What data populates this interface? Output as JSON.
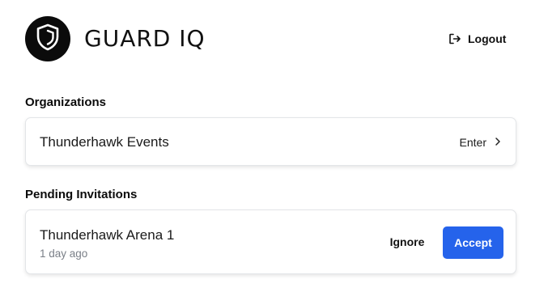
{
  "header": {
    "brand_name": "GUARD IQ",
    "logo_icon": "shield-icon",
    "logout_label": "Logout",
    "logout_icon": "logout-arrow-icon"
  },
  "organizations": {
    "heading": "Organizations",
    "items": [
      {
        "name": "Thunderhawk Events",
        "action_label": "Enter",
        "action_icon": "chevron-right-icon"
      }
    ]
  },
  "invitations": {
    "heading": "Pending Invitations",
    "items": [
      {
        "name": "Thunderhawk Arena 1",
        "time_ago": "1 day ago",
        "ignore_label": "Ignore",
        "accept_label": "Accept"
      }
    ]
  },
  "colors": {
    "accent": "#2563eb",
    "logo_bg": "#0b0b0b",
    "muted_text": "#7a7f87",
    "card_border": "#e3e5e8"
  }
}
